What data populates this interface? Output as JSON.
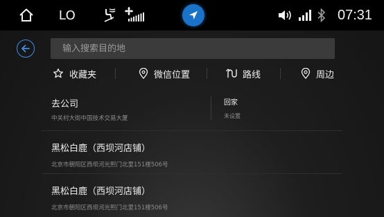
{
  "statusbar": {
    "fan_label": "LO",
    "time": "07:31",
    "colors": {
      "background": "#000000",
      "nav_accent": "#1a73c9"
    },
    "icons": [
      "home-icon",
      "seat-airflow-icon",
      "fan-level-icon",
      "navigation-icon",
      "volume-icon",
      "signal-icon",
      "bluetooth-icon"
    ]
  },
  "search": {
    "placeholder": "输入搜索目的地",
    "value": ""
  },
  "actions": [
    {
      "label": "收藏夹",
      "icon": "star-icon"
    },
    {
      "label": "微信位置",
      "icon": "location-pin-icon"
    },
    {
      "label": "路线",
      "icon": "route-icon"
    },
    {
      "label": "周边",
      "icon": "nearby-search-icon"
    }
  ],
  "quick": {
    "work": {
      "title": "去公司",
      "subtitle": "中关村大街中国技术交易大厦"
    },
    "home": {
      "title": "回家",
      "subtitle": "未设置"
    }
  },
  "results": [
    {
      "title": "黑松白鹿（西坝河店铺）",
      "address": "北京市朝阳区西坝河光熙门北里151楼506号"
    },
    {
      "title": "黑松白鹿（西坝河店铺）",
      "address": "北京市朝阳区西坝河光熙门北里151楼506号"
    }
  ],
  "accent_color": "#3f8fe8"
}
